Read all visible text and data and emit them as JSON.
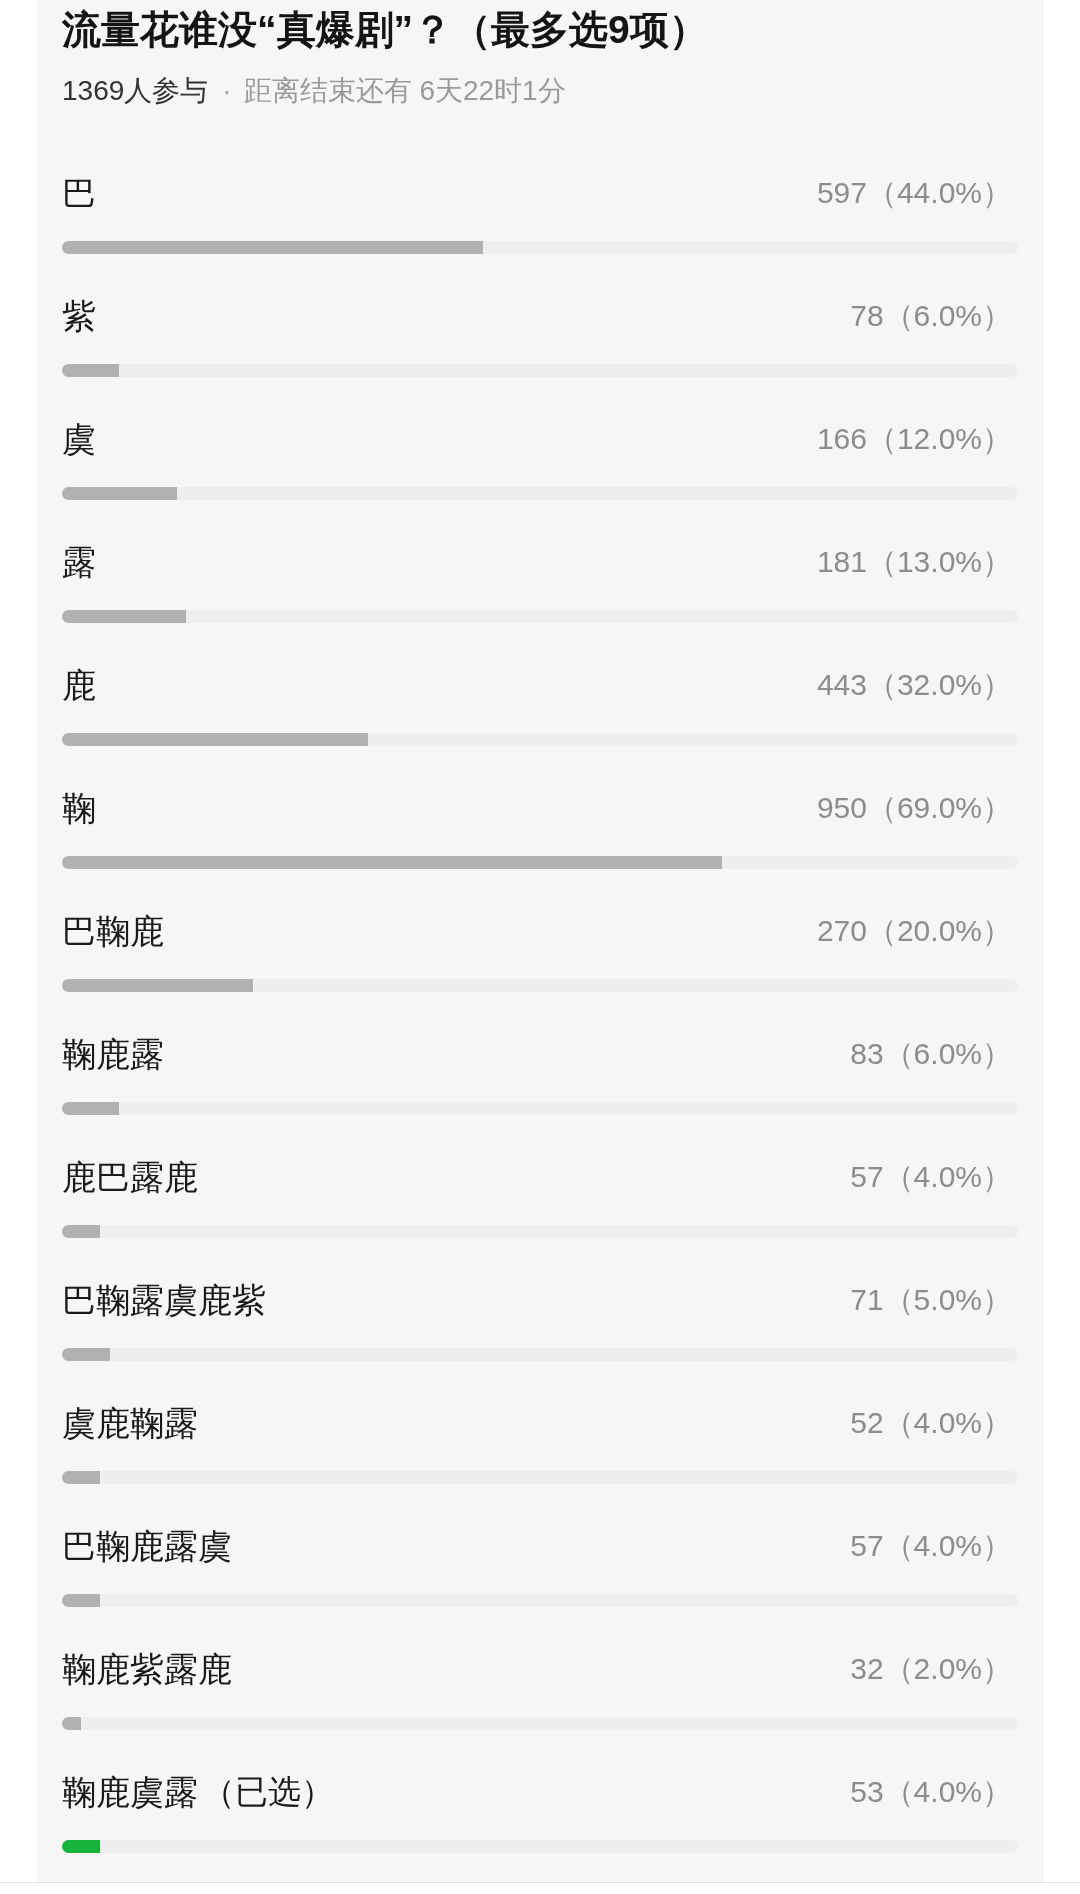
{
  "poll": {
    "title": "流量花谁没“真爆剧”？（最多选9项）",
    "participants": "1369人参与",
    "separator": "·",
    "countdown": "距离结束还有 6天22时1分",
    "selected_note": "（已选）",
    "options": [
      {
        "label": "巴",
        "votes": "597（44.0%）",
        "level": 0.44,
        "selected": false
      },
      {
        "label": "紫",
        "votes": "78（6.0%）",
        "level": 0.06,
        "selected": false
      },
      {
        "label": "虞",
        "votes": "166（12.0%）",
        "level": 0.12,
        "selected": false
      },
      {
        "label": "露",
        "votes": "181（13.0%）",
        "level": 0.13,
        "selected": false
      },
      {
        "label": "鹿",
        "votes": "443（32.0%）",
        "level": 0.32,
        "selected": false
      },
      {
        "label": "鞠",
        "votes": "950（69.0%）",
        "level": 0.69,
        "selected": false
      },
      {
        "label": "巴鞠鹿",
        "votes": "270（20.0%）",
        "level": 0.2,
        "selected": false
      },
      {
        "label": "鞠鹿露",
        "votes": "83（6.0%）",
        "level": 0.06,
        "selected": false
      },
      {
        "label": "鹿巴露鹿",
        "votes": "57（4.0%）",
        "level": 0.04,
        "selected": false
      },
      {
        "label": "巴鞠露虞鹿紫",
        "votes": "71（5.0%）",
        "level": 0.05,
        "selected": false
      },
      {
        "label": "虞鹿鞠露",
        "votes": "52（4.0%）",
        "level": 0.04,
        "selected": false
      },
      {
        "label": "巴鞠鹿露虞",
        "votes": "57（4.0%）",
        "level": 0.04,
        "selected": false
      },
      {
        "label": "鞠鹿紫露鹿",
        "votes": "32（2.0%）",
        "level": 0.02,
        "selected": false
      },
      {
        "label": "鞠鹿虞露",
        "votes": "53（4.0%）",
        "level": 0.04,
        "selected": true
      }
    ]
  }
}
